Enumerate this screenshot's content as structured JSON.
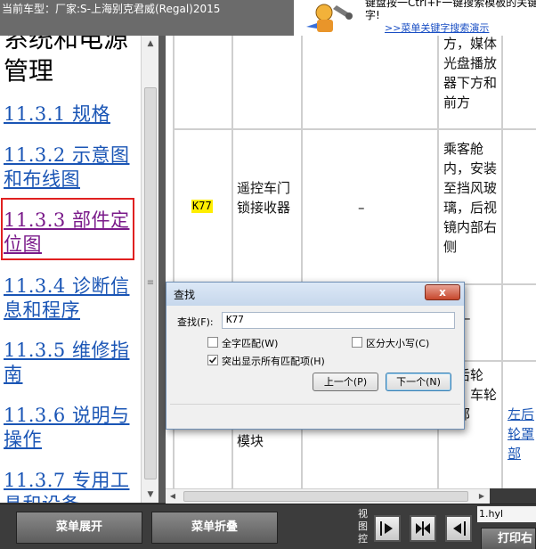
{
  "header": {
    "vehicle": "当前车型：厂家:S-上海别克君威(Regal)2015",
    "promo_line1": "键盘按一Ctrl+F一键搜索模板的关键",
    "promo_line2": "字!",
    "promo_link": ">>菜单关键字搜索演示"
  },
  "nav": {
    "heading": "系统和电源管理",
    "items": [
      {
        "label": "11.3.1 规格"
      },
      {
        "label": "11.3.2 示意图和布线图"
      },
      {
        "label": "11.3.3 部件定位图"
      },
      {
        "label": "11.3.4 诊断信息和程序"
      },
      {
        "label": "11.3.5 维修指南"
      },
      {
        "label": "11.3.6 说明与操作"
      },
      {
        "label": "11.3.7 专用工具和设备"
      }
    ]
  },
  "table": {
    "row1_location": "方，媒体光盘播放器下方和前方",
    "row2": {
      "code": "K77",
      "name": "遥控车门锁接收器",
      "connector": "–",
      "location": "乘客舱内，安装至挡风玻璃，后视镜内部右侧"
    },
    "row3_connector": "–",
    "row4": {
      "name_tail": "模块",
      "location": "左后轮罩，车轮后部",
      "link": "左后轮罩部"
    }
  },
  "find_dialog": {
    "title": "查找",
    "close": "x",
    "find_label": "查找(F):",
    "find_value": "K77",
    "whole_word": {
      "label": "全字匹配(W)",
      "checked": false
    },
    "match_case": {
      "label": "区分大小写(C)",
      "checked": false
    },
    "highlight_all": {
      "label": "突出显示所有匹配项(H)",
      "checked": true
    },
    "prev_button": "上一个(P)",
    "next_button": "下一个(N)"
  },
  "toolbar": {
    "expand_menu": "菜单展开",
    "collapse_menu": "菜单折叠",
    "view_control": "视图控",
    "filename": "1.hyl",
    "print": "打印右"
  }
}
